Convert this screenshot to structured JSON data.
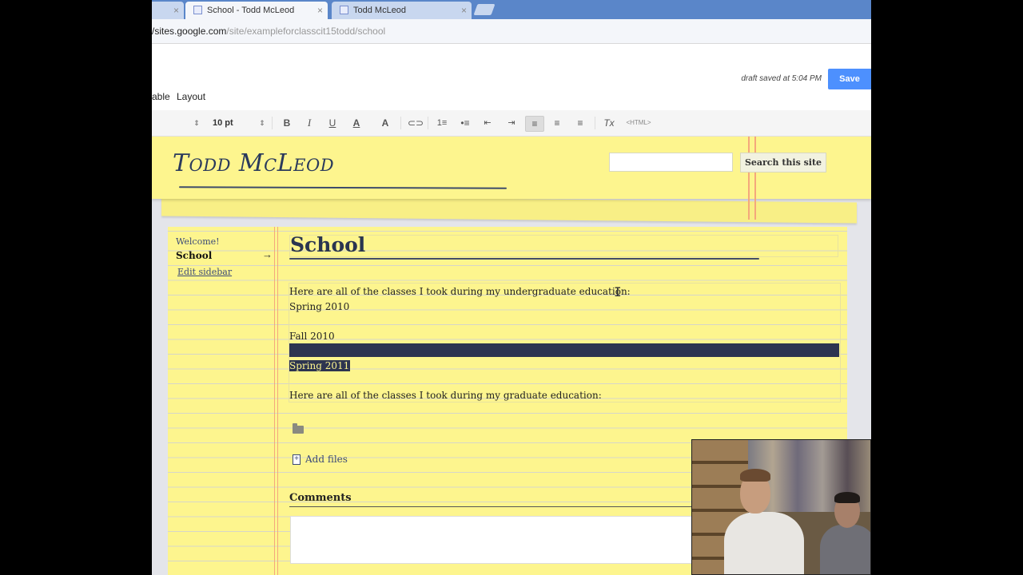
{
  "browser": {
    "tabs": [
      {
        "label": "",
        "close": "×"
      },
      {
        "label": "School - Todd McLeod",
        "close": "×"
      },
      {
        "label": "Todd McLeod",
        "close": "×"
      }
    ],
    "url_host": "/sites.google.com",
    "url_path": "/site/exampleforclasscit15todd/school"
  },
  "editor": {
    "draft_status": "draft saved at 5:04 PM",
    "save_label": "Save",
    "menu_table": "able",
    "menu_layout": "Layout",
    "toolbar": {
      "font_arrow": "⇕",
      "size": "10 pt",
      "size_arrow": "⇕",
      "bold": "B",
      "italic": "I",
      "underline": "U",
      "text_color": "A",
      "bg_color": "A",
      "link": "⊂⊃",
      "ordered_list": "1≡",
      "bullet_list": "•≡",
      "indent_less": "⇤",
      "indent_more": "⇥",
      "align_left": "≡",
      "align_center": "≡",
      "align_right": "≡",
      "clear_format": "Tx",
      "html": "<HTML>"
    }
  },
  "site": {
    "title": "Todd McLeod",
    "search_button": "Search this site",
    "sidebar": {
      "items": [
        {
          "label": "Welcome!"
        },
        {
          "label": "School",
          "arrow": "→"
        }
      ],
      "edit_label": "Edit sidebar"
    },
    "page_title": "School",
    "content": {
      "undergrad": "Here are all of the classes I took during my undergraduate education:",
      "spring2010": "Spring 2010",
      "fall2010": "Fall 2010",
      "spring2011": "Spring 2011",
      "grad": "Here are all of the classes I took during my graduate education:"
    },
    "add_files": "Add files",
    "comments": "Comments"
  }
}
